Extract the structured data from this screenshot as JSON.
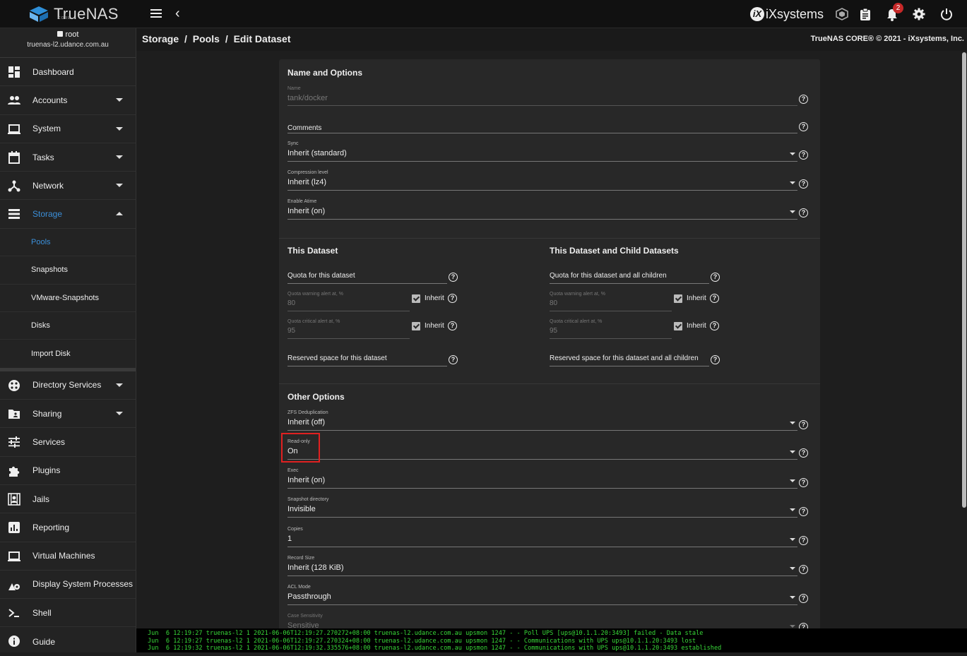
{
  "app": {
    "brand": "TrueNAS",
    "brand_sub": "CORE",
    "vendor": "iXsystems",
    "notification_count": "2"
  },
  "user": {
    "name": "root",
    "host": "truenas-l2.udance.com.au"
  },
  "sidebar": {
    "items": [
      {
        "label": "Dashboard",
        "icon": "dashboard-icon"
      },
      {
        "label": "Accounts",
        "icon": "accounts-icon"
      },
      {
        "label": "System",
        "icon": "laptop-icon"
      },
      {
        "label": "Tasks",
        "icon": "calendar-icon"
      },
      {
        "label": "Network",
        "icon": "network-icon"
      },
      {
        "label": "Storage",
        "icon": "storage-icon"
      }
    ],
    "storage_sub": [
      "Pools",
      "Snapshots",
      "VMware-Snapshots",
      "Disks",
      "Import Disk"
    ],
    "items2": [
      {
        "label": "Directory Services",
        "icon": "directory-icon"
      },
      {
        "label": "Sharing",
        "icon": "folder-share-icon"
      },
      {
        "label": "Services",
        "icon": "tune-icon"
      },
      {
        "label": "Plugins",
        "icon": "puzzle-icon"
      },
      {
        "label": "Jails",
        "icon": "jail-icon"
      },
      {
        "label": "Reporting",
        "icon": "chart-icon"
      },
      {
        "label": "Virtual Machines",
        "icon": "computer-icon"
      },
      {
        "label": "Display System Processes",
        "icon": "processes-icon"
      },
      {
        "label": "Shell",
        "icon": "terminal-icon"
      },
      {
        "label": "Guide",
        "icon": "info-icon"
      }
    ]
  },
  "breadcrumb": [
    "Storage",
    "/",
    "Pools",
    "/",
    "Edit Dataset"
  ],
  "copyright": "TrueNAS CORE® © 2021 - iXsystems, Inc.",
  "form": {
    "section1_title": "Name and Options",
    "name": {
      "label": "Name",
      "value": "tank/docker"
    },
    "comments": {
      "label": "Comments"
    },
    "sync": {
      "label": "Sync",
      "value": "Inherit (standard)"
    },
    "compression": {
      "label": "Compression level",
      "value": "Inherit (lz4)"
    },
    "atime": {
      "label": "Enable Atime",
      "value": "Inherit (on)"
    },
    "section2_title": "This Dataset",
    "section3_title": "This Dataset and Child Datasets",
    "quota": {
      "label": "Quota for this dataset"
    },
    "quota_warn": {
      "label": "Quota warning alert at, %",
      "value": "80"
    },
    "quota_crit": {
      "label": "Quota critical alert at, %",
      "value": "95"
    },
    "reserved": {
      "label": "Reserved space for this dataset"
    },
    "quota_children": {
      "label": "Quota for this dataset and all children"
    },
    "quota_warn_children": {
      "label": "Quota warning alert at, %",
      "value": "80"
    },
    "quota_crit_children": {
      "label": "Quota critical alert at, %",
      "value": "95"
    },
    "reserved_children": {
      "label": "Reserved space for this dataset and all children"
    },
    "inherit_label": "Inherit",
    "section4_title": "Other Options",
    "dedup": {
      "label": "ZFS Deduplication",
      "value": "Inherit (off)"
    },
    "readonly": {
      "label": "Read-only",
      "value": "On"
    },
    "exec": {
      "label": "Exec",
      "value": "Inherit (on)"
    },
    "snapdir": {
      "label": "Snapshot directory",
      "value": "Invisible"
    },
    "copies": {
      "label": "Copies",
      "value": "1"
    },
    "recordsize": {
      "label": "Record Size",
      "value": "Inherit (128 KiB)"
    },
    "aclmode": {
      "label": "ACL Mode",
      "value": "Passthrough"
    },
    "casesens": {
      "label": "Case Sensitivity",
      "value": "Sensitive"
    }
  },
  "console": [
    "Jun  6 12:19:27 truenas-l2 1 2021-06-06T12:19:27.270272+08:00 truenas-l2.udance.com.au upsmon 1247 - - Poll UPS [ups@10.1.1.20:3493] failed - Data stale",
    "Jun  6 12:19:27 truenas-l2 1 2021-06-06T12:19:27.270324+08:00 truenas-l2.udance.com.au upsmon 1247 - - Communications with UPS ups@10.1.1.20:3493 lost",
    "Jun  6 12:19:32 truenas-l2 1 2021-06-06T12:19:32.335576+08:00 truenas-l2.udance.com.au upsmon 1247 - - Communications with UPS ups@10.1.1.20:3493 established"
  ],
  "colors": {
    "accent": "#3b8fd9",
    "highlight": "#e02020",
    "console_text": "#38d838",
    "badge": "#c62828"
  }
}
